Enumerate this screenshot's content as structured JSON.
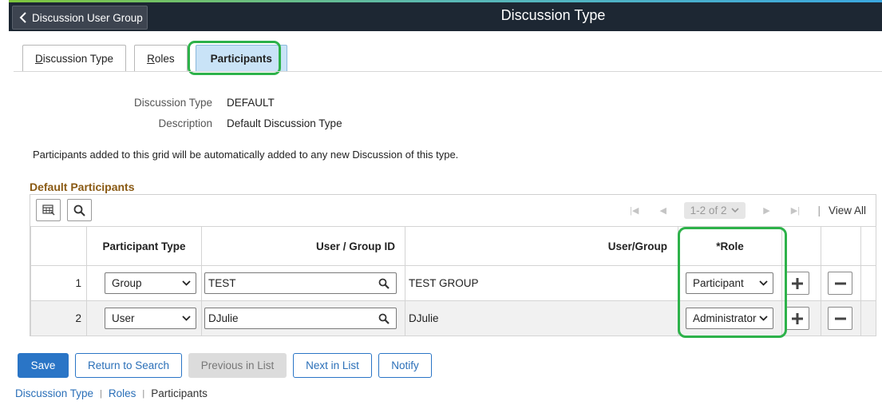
{
  "header": {
    "back_label": "Discussion User Group",
    "title": "Discussion Type"
  },
  "tabs": [
    {
      "prefix": "",
      "accesskey": "D",
      "rest": "iscussion Type",
      "active": false
    },
    {
      "prefix": "",
      "accesskey": "R",
      "rest": "oles",
      "active": false
    },
    {
      "prefix": "",
      "accesskey": "",
      "rest": "Participants",
      "active": true
    }
  ],
  "form": {
    "discussion_type_label": "Discussion Type",
    "discussion_type_value": "DEFAULT",
    "description_label": "Description",
    "description_value": "Default Discussion Type"
  },
  "note": "Participants added to this grid will be automatically added to any new Discussion of this type.",
  "grid": {
    "title": "Default Participants",
    "pager_range": "1-2 of 2",
    "view_all": "View All",
    "columns": {
      "participant_type": "Participant Type",
      "user_group_id": "User / Group ID",
      "user_group": "User/Group",
      "role": "*Role"
    },
    "rows": [
      {
        "num": "1",
        "participant_type": "Group",
        "user_group_id": "TEST",
        "user_group": "TEST GROUP",
        "role": "Participant"
      },
      {
        "num": "2",
        "participant_type": "User",
        "user_group_id": "DJulie",
        "user_group": "DJulie",
        "role": "Administrator"
      }
    ]
  },
  "buttons": {
    "save": "Save",
    "return_to_search": "Return to Search",
    "previous_in_list": "Previous in List",
    "next_in_list": "Next in List",
    "notify": "Notify"
  },
  "footer_links": [
    "Discussion Type",
    "Roles",
    "Participants"
  ],
  "colors": {
    "topbar": "#1d2733",
    "active_tab": "#c9e3f7",
    "highlight": "#2db24a",
    "section_title": "#8a5a14",
    "primary_button": "#2a75c6"
  },
  "icons": [
    "chevron-left-icon",
    "personalize-grid-icon",
    "search-icon",
    "first-page-icon",
    "previous-page-icon",
    "next-page-icon",
    "last-page-icon",
    "chevron-down-icon",
    "lookup-icon",
    "add-row-icon",
    "delete-row-icon"
  ]
}
